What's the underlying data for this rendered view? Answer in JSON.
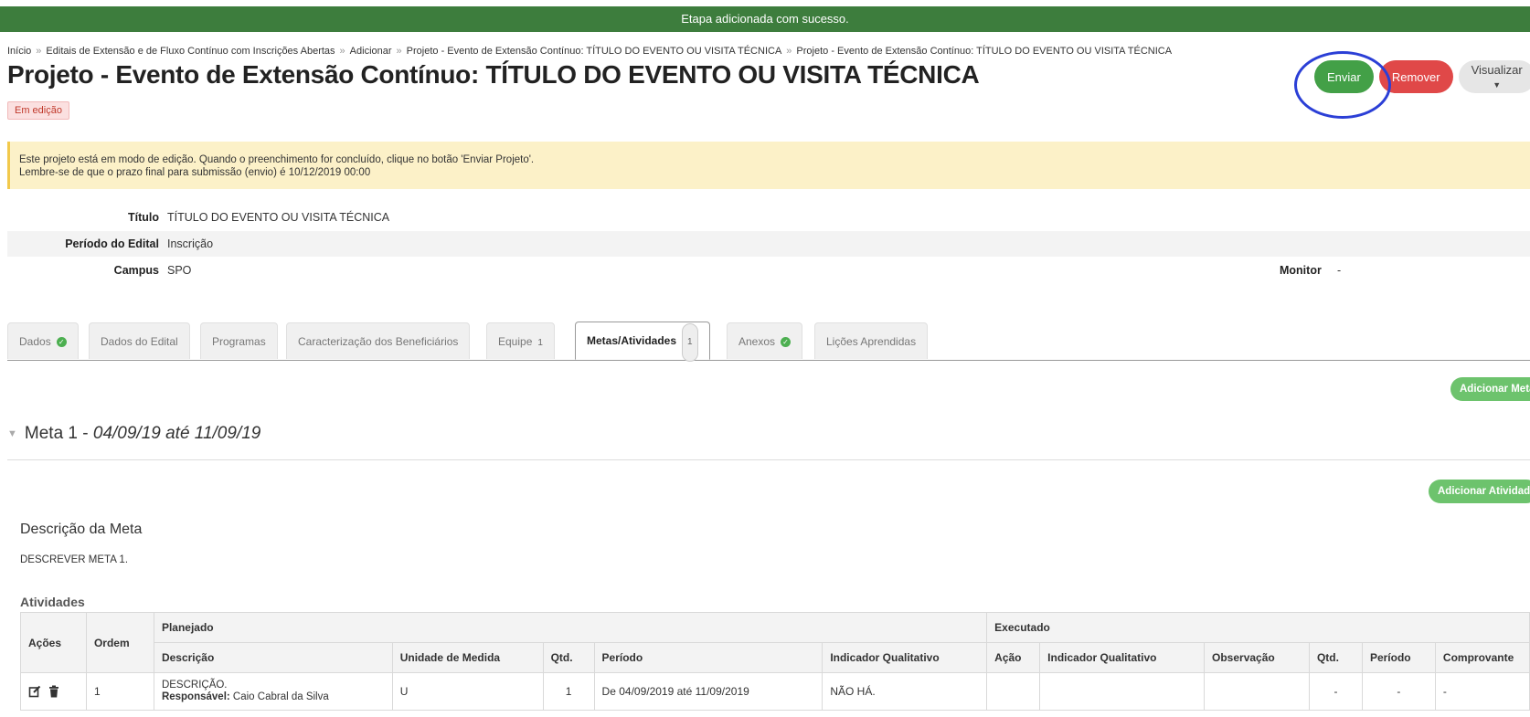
{
  "flash": {
    "message": "Etapa adicionada com sucesso."
  },
  "breadcrumb": [
    "Início",
    "Editais de Extensão e de Fluxo Contínuo com Inscrições Abertas",
    "Adicionar",
    "Projeto - Evento de Extensão Contínuo: TÍTULO DO EVENTO OU VISITA TÉCNICA",
    "Projeto - Evento de Extensão Contínuo: TÍTULO DO EVENTO OU VISITA TÉCNICA"
  ],
  "page": {
    "title": "Projeto - Evento de Extensão Contínuo: TÍTULO DO EVENTO OU VISITA TÉCNICA",
    "status": "Em edição"
  },
  "actions": {
    "send": "Enviar",
    "remove": "Remover",
    "view": "Visualizar"
  },
  "warning": {
    "line1": "Este projeto está em modo de edição. Quando o preenchimento for concluído, clique no botão 'Enviar Projeto'.",
    "line2": "Lembre-se de que o prazo final para submissão (envio) é 10/12/2019 00:00"
  },
  "details": {
    "titulo_label": "Título",
    "titulo_value": "TÍTULO DO EVENTO OU VISITA TÉCNICA",
    "periodo_label": "Período do Edital",
    "periodo_value": "Inscrição",
    "campus_label": "Campus",
    "campus_value": "SPO",
    "monitor_label": "Monitor",
    "monitor_value": "-"
  },
  "tabs": [
    {
      "label": "Dados",
      "check": true
    },
    {
      "label": "Dados do Edital"
    },
    {
      "label": "Programas"
    },
    {
      "label": "Caracterização dos Beneficiários"
    },
    {
      "label": "Equipe",
      "count": "1"
    },
    {
      "label": "Metas/Atividades",
      "count": "1",
      "active": true
    },
    {
      "label": "Anexos",
      "check": true
    },
    {
      "label": "Lições Aprendidas"
    }
  ],
  "buttons": {
    "add_meta": "Adicionar Meta",
    "add_atividade": "Adicionar Atividade"
  },
  "meta": {
    "prefix": "Meta 1 - ",
    "period": "04/09/19 até 11/09/19",
    "desc_title": "Descrição da Meta",
    "desc_text": "DESCREVER META 1."
  },
  "atividades": {
    "title": "Atividades",
    "headers": {
      "acoes": "Ações",
      "ordem": "Ordem",
      "planejado": "Planejado",
      "executado": "Executado",
      "descricao": "Descrição",
      "unidade": "Unidade de Medida",
      "qtd": "Qtd.",
      "periodo": "Período",
      "indicador": "Indicador Qualitativo",
      "acao": "Ação",
      "indicador_exec": "Indicador Qualitativo",
      "observacao": "Observação",
      "qtd_exec": "Qtd.",
      "periodo_exec": "Período",
      "comprovante": "Comprovante"
    },
    "rows": [
      {
        "ordem": "1",
        "descricao": "DESCRIÇÃO.",
        "responsavel_label": "Responsável:",
        "responsavel": "Caio Cabral da Silva",
        "unidade": "U",
        "qtd": "1",
        "periodo": "De 04/09/2019 até 11/09/2019",
        "indicador": "NÃO HÁ.",
        "acao": "",
        "indicador_exec": "",
        "observacao": "",
        "qtd_exec": "-",
        "periodo_exec": "-",
        "comprovante": "-"
      }
    ]
  }
}
